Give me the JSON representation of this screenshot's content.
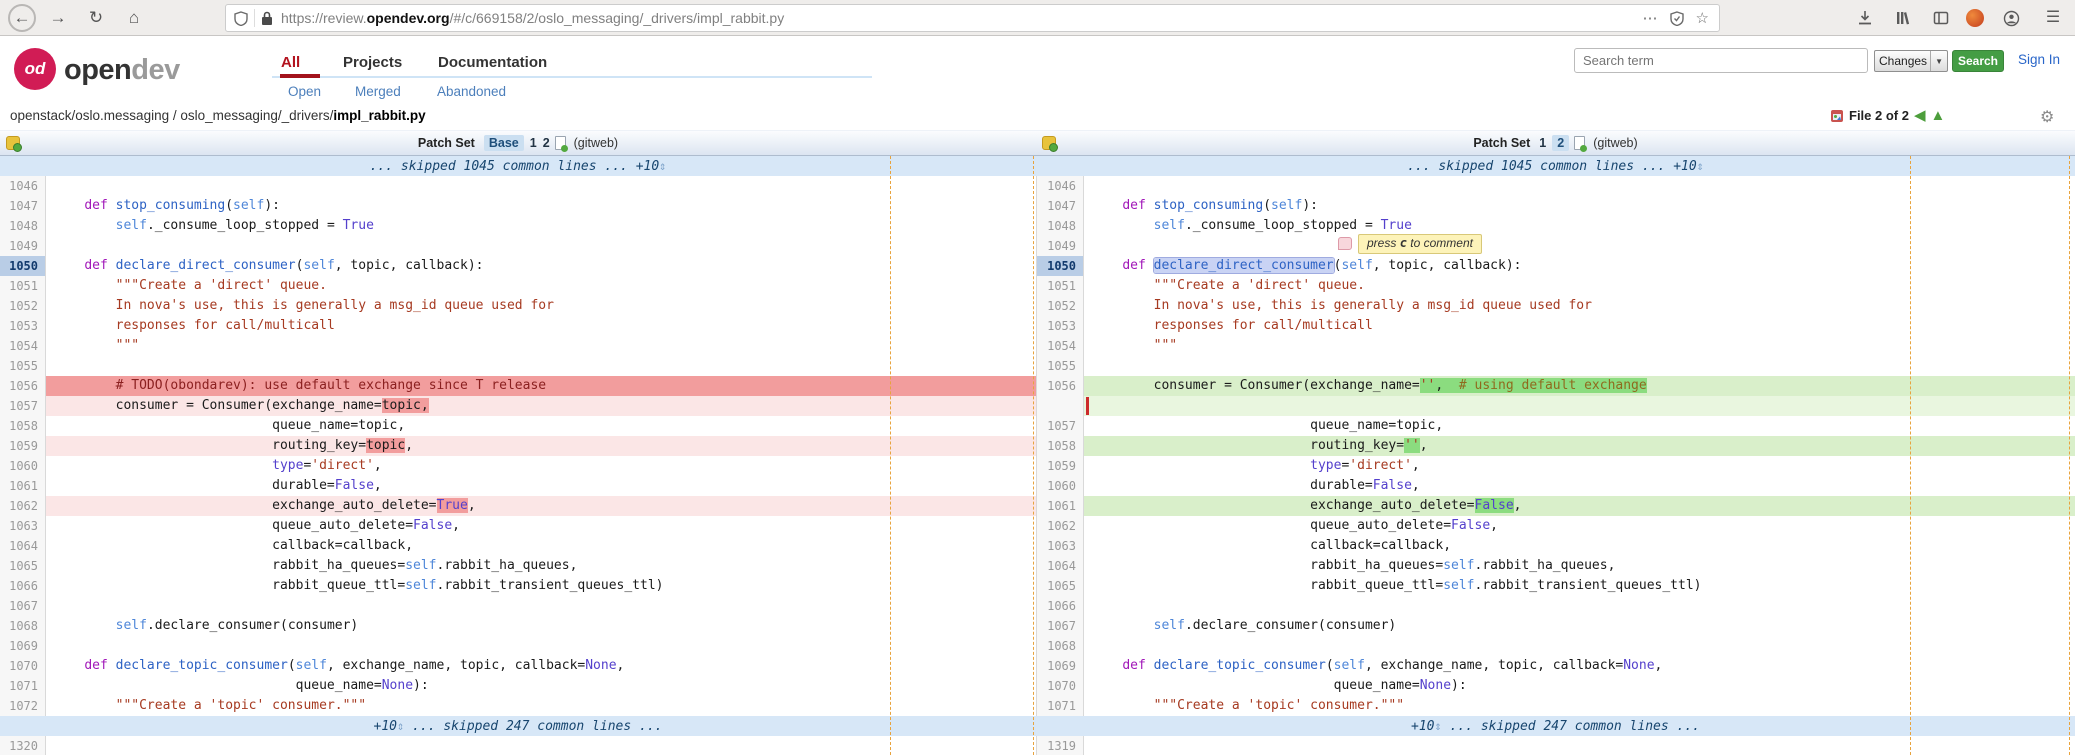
{
  "browser": {
    "url_prefix": "https://review.",
    "url_domain": "opendev.org",
    "url_path": "/#/c/669158/2/oslo_messaging/_drivers/impl_rabbit.py"
  },
  "icons": {
    "back": "←",
    "forward": "→",
    "reload": "↻",
    "home": "⌂",
    "more": "⋯",
    "star": "☆",
    "menu": "☰",
    "gear": "⚙",
    "nav_prev": "◀",
    "nav_up": "▲",
    "expand_arrows": "⇕",
    "changes_caret": "▼"
  },
  "header": {
    "logo_badge": "od",
    "logo_text_1": "open",
    "logo_text_2": "dev",
    "tabs": [
      {
        "label": "All"
      },
      {
        "label": "Projects"
      },
      {
        "label": "Documentation"
      }
    ],
    "subtabs": [
      {
        "label": "Open"
      },
      {
        "label": "Merged"
      },
      {
        "label": "Abandoned"
      }
    ],
    "search_placeholder": "Search term",
    "scope_select": "Changes",
    "search_button": "Search",
    "sign_in": "Sign In"
  },
  "breadcrumb": {
    "prefix": "openstack/oslo.messaging / oslo_messaging/_drivers/",
    "file": "impl_rabbit.py"
  },
  "file_nav": {
    "label": "File 2 of 2"
  },
  "patch_headers": {
    "left": {
      "label": "Patch Set",
      "options": [
        "Base",
        "1",
        "2"
      ],
      "selected": "Base",
      "gitweb": "(gitweb)"
    },
    "right": {
      "label": "Patch Set",
      "options": [
        "1",
        "2"
      ],
      "selected": "2",
      "gitweb": "(gitweb)"
    }
  },
  "tooltip": {
    "pre": "press ",
    "key": "c",
    "post": " to comment"
  },
  "diff_rows": [
    {
      "type": "banner",
      "pre": "... skipped 1045 common lines ... ",
      "expand": "+10",
      "post": ""
    },
    {
      "l": {
        "n": "1046",
        "bg": "",
        "segs": []
      },
      "r": {
        "n": "1046",
        "bg": "",
        "segs": []
      }
    },
    {
      "l": {
        "n": "1047",
        "bg": "",
        "segs": [
          [
            "    ",
            ""
          ],
          [
            "def",
            "k"
          ],
          [
            " ",
            ""
          ],
          [
            "stop_consuming",
            "f"
          ],
          [
            "(",
            ""
          ],
          [
            "self",
            "sf"
          ],
          [
            "):",
            ""
          ]
        ]
      },
      "r": {
        "n": "1047",
        "bg": "",
        "segs": [
          [
            "    ",
            ""
          ],
          [
            "def",
            "k"
          ],
          [
            " ",
            ""
          ],
          [
            "stop_consuming",
            "f"
          ],
          [
            "(",
            ""
          ],
          [
            "self",
            "sf"
          ],
          [
            "):",
            ""
          ]
        ]
      }
    },
    {
      "l": {
        "n": "1048",
        "bg": "",
        "segs": [
          [
            "        ",
            ""
          ],
          [
            "self",
            "sf"
          ],
          [
            "._consume_loop_stopped = ",
            ""
          ],
          [
            "True",
            "c"
          ]
        ]
      },
      "r": {
        "n": "1048",
        "bg": "",
        "segs": [
          [
            "        ",
            ""
          ],
          [
            "self",
            "sf"
          ],
          [
            "._consume_loop_stopped = ",
            ""
          ],
          [
            "True",
            "c"
          ]
        ]
      }
    },
    {
      "l": {
        "n": "1049",
        "bg": "",
        "segs": []
      },
      "r": {
        "n": "1049",
        "bg": "",
        "segs": []
      }
    },
    {
      "l": {
        "n": "1050",
        "hl": true,
        "bg": "",
        "segs": [
          [
            "    ",
            ""
          ],
          [
            "def",
            "k"
          ],
          [
            " ",
            ""
          ],
          [
            "declare_direct_consumer",
            "f"
          ],
          [
            "(",
            ""
          ],
          [
            "self",
            "sf"
          ],
          [
            ", topic, callback):",
            ""
          ]
        ]
      },
      "r": {
        "n": "1050",
        "hl": true,
        "bg": "",
        "segs": [
          [
            "    ",
            ""
          ],
          [
            "def",
            "k"
          ],
          [
            " ",
            ""
          ],
          [
            "declare_direct_consumer",
            "f sel"
          ],
          [
            "(",
            ""
          ],
          [
            "self",
            "sf"
          ],
          [
            ", topic, callback):",
            ""
          ]
        ]
      }
    },
    {
      "l": {
        "n": "1051",
        "bg": "",
        "segs": [
          [
            "        ",
            ""
          ],
          [
            "\"\"\"Create a 'direct' queue.",
            "s"
          ]
        ]
      },
      "r": {
        "n": "1051",
        "bg": "",
        "segs": [
          [
            "        ",
            ""
          ],
          [
            "\"\"\"Create a 'direct' queue.",
            "s"
          ]
        ]
      }
    },
    {
      "l": {
        "n": "1052",
        "bg": "",
        "segs": [
          [
            "        ",
            ""
          ],
          [
            "In nova's use, this is generally a msg_id queue used for",
            "s"
          ]
        ]
      },
      "r": {
        "n": "1052",
        "bg": "",
        "segs": [
          [
            "        ",
            ""
          ],
          [
            "In nova's use, this is generally a msg_id queue used for",
            "s"
          ]
        ]
      }
    },
    {
      "l": {
        "n": "1053",
        "bg": "",
        "segs": [
          [
            "        ",
            ""
          ],
          [
            "responses for call/multicall",
            "s"
          ]
        ]
      },
      "r": {
        "n": "1053",
        "bg": "",
        "segs": [
          [
            "        ",
            ""
          ],
          [
            "responses for call/multicall",
            "s"
          ]
        ]
      }
    },
    {
      "l": {
        "n": "1054",
        "bg": "",
        "segs": [
          [
            "        ",
            ""
          ],
          [
            "\"\"\"",
            "s"
          ]
        ]
      },
      "r": {
        "n": "1054",
        "bg": "",
        "segs": [
          [
            "        ",
            ""
          ],
          [
            "\"\"\"",
            "s"
          ]
        ]
      }
    },
    {
      "l": {
        "n": "1055",
        "bg": "",
        "segs": []
      },
      "r": {
        "n": "1055",
        "bg": "",
        "segs": []
      }
    },
    {
      "l": {
        "n": "1056",
        "bg": "del",
        "segs": [
          [
            "        ",
            ""
          ],
          [
            "# TODO(obondarev): use default exchange since T release",
            "dc"
          ]
        ]
      },
      "r": {
        "n": "1056",
        "bg": "addl",
        "segs": [
          [
            "        ",
            ""
          ],
          [
            "consumer = Consumer(exchange_name=",
            ""
          ],
          [
            "''",
            "s hg"
          ],
          [
            ",  ",
            "hg"
          ],
          [
            "# using default exchange",
            "g hg"
          ]
        ]
      }
    },
    {
      "l": {
        "n": "1057",
        "bg": "dell",
        "segs": [
          [
            "        ",
            ""
          ],
          [
            "consumer = Consumer(exchange_name=",
            ""
          ],
          [
            "topic,",
            "hr"
          ]
        ]
      },
      "r": {
        "n": "",
        "bg": "fill",
        "segs": []
      }
    },
    {
      "l": {
        "n": "1058",
        "bg": "",
        "segs": [
          [
            "                            queue_name=topic,",
            ""
          ]
        ]
      },
      "r": {
        "n": "1057",
        "bg": "",
        "segs": [
          [
            "                            queue_name=topic,",
            ""
          ]
        ]
      }
    },
    {
      "l": {
        "n": "1059",
        "bg": "dell",
        "segs": [
          [
            "                            routing_key=",
            ""
          ],
          [
            "topic",
            "hr"
          ],
          [
            ",",
            ""
          ]
        ]
      },
      "r": {
        "n": "1058",
        "bg": "addl",
        "segs": [
          [
            "                            routing_key=",
            ""
          ],
          [
            "''",
            "s hg"
          ],
          [
            ",",
            ""
          ]
        ]
      }
    },
    {
      "l": {
        "n": "1060",
        "bg": "",
        "segs": [
          [
            "                            ",
            ""
          ],
          [
            "type",
            "c"
          ],
          [
            "=",
            ""
          ],
          [
            "'direct'",
            "s"
          ],
          [
            ",",
            ""
          ]
        ]
      },
      "r": {
        "n": "1059",
        "bg": "",
        "segs": [
          [
            "                            ",
            ""
          ],
          [
            "type",
            "c"
          ],
          [
            "=",
            ""
          ],
          [
            "'direct'",
            "s"
          ],
          [
            ",",
            ""
          ]
        ]
      }
    },
    {
      "l": {
        "n": "1061",
        "bg": "",
        "segs": [
          [
            "                            durable=",
            ""
          ],
          [
            "False",
            "c"
          ],
          [
            ",",
            ""
          ]
        ]
      },
      "r": {
        "n": "1060",
        "bg": "",
        "segs": [
          [
            "                            durable=",
            ""
          ],
          [
            "False",
            "c"
          ],
          [
            ",",
            ""
          ]
        ]
      }
    },
    {
      "l": {
        "n": "1062",
        "bg": "dell",
        "segs": [
          [
            "                            exchange_auto_delete=",
            ""
          ],
          [
            "True",
            "c hr"
          ],
          [
            ",",
            ""
          ]
        ]
      },
      "r": {
        "n": "1061",
        "bg": "addl",
        "segs": [
          [
            "                            exchange_auto_delete=",
            ""
          ],
          [
            "False",
            "c hg"
          ],
          [
            ",",
            ""
          ]
        ]
      }
    },
    {
      "l": {
        "n": "1063",
        "bg": "",
        "segs": [
          [
            "                            queue_auto_delete=",
            ""
          ],
          [
            "False",
            "c"
          ],
          [
            ",",
            ""
          ]
        ]
      },
      "r": {
        "n": "1062",
        "bg": "",
        "segs": [
          [
            "                            queue_auto_delete=",
            ""
          ],
          [
            "False",
            "c"
          ],
          [
            ",",
            ""
          ]
        ]
      }
    },
    {
      "l": {
        "n": "1064",
        "bg": "",
        "segs": [
          [
            "                            callback=callback,",
            ""
          ]
        ]
      },
      "r": {
        "n": "1063",
        "bg": "",
        "segs": [
          [
            "                            callback=callback,",
            ""
          ]
        ]
      }
    },
    {
      "l": {
        "n": "1065",
        "bg": "",
        "segs": [
          [
            "                            rabbit_ha_queues=",
            ""
          ],
          [
            "self",
            "sf"
          ],
          [
            ".rabbit_ha_queues,",
            ""
          ]
        ]
      },
      "r": {
        "n": "1064",
        "bg": "",
        "segs": [
          [
            "                            rabbit_ha_queues=",
            ""
          ],
          [
            "self",
            "sf"
          ],
          [
            ".rabbit_ha_queues,",
            ""
          ]
        ]
      }
    },
    {
      "l": {
        "n": "1066",
        "bg": "",
        "segs": [
          [
            "                            rabbit_queue_ttl=",
            ""
          ],
          [
            "self",
            "sf"
          ],
          [
            ".rabbit_transient_queues_ttl)",
            ""
          ]
        ]
      },
      "r": {
        "n": "1065",
        "bg": "",
        "segs": [
          [
            "                            rabbit_queue_ttl=",
            ""
          ],
          [
            "self",
            "sf"
          ],
          [
            ".rabbit_transient_queues_ttl)",
            ""
          ]
        ]
      }
    },
    {
      "l": {
        "n": "1067",
        "bg": "",
        "segs": []
      },
      "r": {
        "n": "1066",
        "bg": "",
        "segs": []
      }
    },
    {
      "l": {
        "n": "1068",
        "bg": "",
        "segs": [
          [
            "        ",
            ""
          ],
          [
            "self",
            "sf"
          ],
          [
            ".declare_consumer(consumer)",
            ""
          ]
        ]
      },
      "r": {
        "n": "1067",
        "bg": "",
        "segs": [
          [
            "        ",
            ""
          ],
          [
            "self",
            "sf"
          ],
          [
            ".declare_consumer(consumer)",
            ""
          ]
        ]
      }
    },
    {
      "l": {
        "n": "1069",
        "bg": "",
        "segs": []
      },
      "r": {
        "n": "1068",
        "bg": "",
        "segs": []
      }
    },
    {
      "l": {
        "n": "1070",
        "bg": "",
        "segs": [
          [
            "    ",
            ""
          ],
          [
            "def",
            "k"
          ],
          [
            " ",
            ""
          ],
          [
            "declare_topic_consumer",
            "f"
          ],
          [
            "(",
            ""
          ],
          [
            "self",
            "sf"
          ],
          [
            ", exchange_name, topic, callback=",
            ""
          ],
          [
            "None",
            "c"
          ],
          [
            ",",
            ""
          ]
        ]
      },
      "r": {
        "n": "1069",
        "bg": "",
        "segs": [
          [
            "    ",
            ""
          ],
          [
            "def",
            "k"
          ],
          [
            " ",
            ""
          ],
          [
            "declare_topic_consumer",
            "f"
          ],
          [
            "(",
            ""
          ],
          [
            "self",
            "sf"
          ],
          [
            ", exchange_name, topic, callback=",
            ""
          ],
          [
            "None",
            "c"
          ],
          [
            ",",
            ""
          ]
        ]
      }
    },
    {
      "l": {
        "n": "1071",
        "bg": "",
        "segs": [
          [
            "                               queue_name=",
            ""
          ],
          [
            "None",
            "c"
          ],
          [
            "):",
            ""
          ]
        ]
      },
      "r": {
        "n": "1070",
        "bg": "",
        "segs": [
          [
            "                               queue_name=",
            ""
          ],
          [
            "None",
            "c"
          ],
          [
            "):",
            ""
          ]
        ]
      }
    },
    {
      "l": {
        "n": "1072",
        "bg": "",
        "segs": [
          [
            "        ",
            ""
          ],
          [
            "\"\"\"Create a 'topic' consumer.\"\"\"",
            "s"
          ]
        ]
      },
      "r": {
        "n": "1071",
        "bg": "",
        "segs": [
          [
            "        ",
            ""
          ],
          [
            "\"\"\"Create a 'topic' consumer.\"\"\"",
            "s"
          ]
        ]
      }
    },
    {
      "type": "banner",
      "pre": "",
      "expand": "+10",
      "post": " ... skipped 247 common lines ..."
    },
    {
      "l": {
        "n": "1320",
        "bg": "",
        "segs": []
      },
      "r": {
        "n": "1319",
        "bg": "",
        "segs": []
      }
    }
  ]
}
